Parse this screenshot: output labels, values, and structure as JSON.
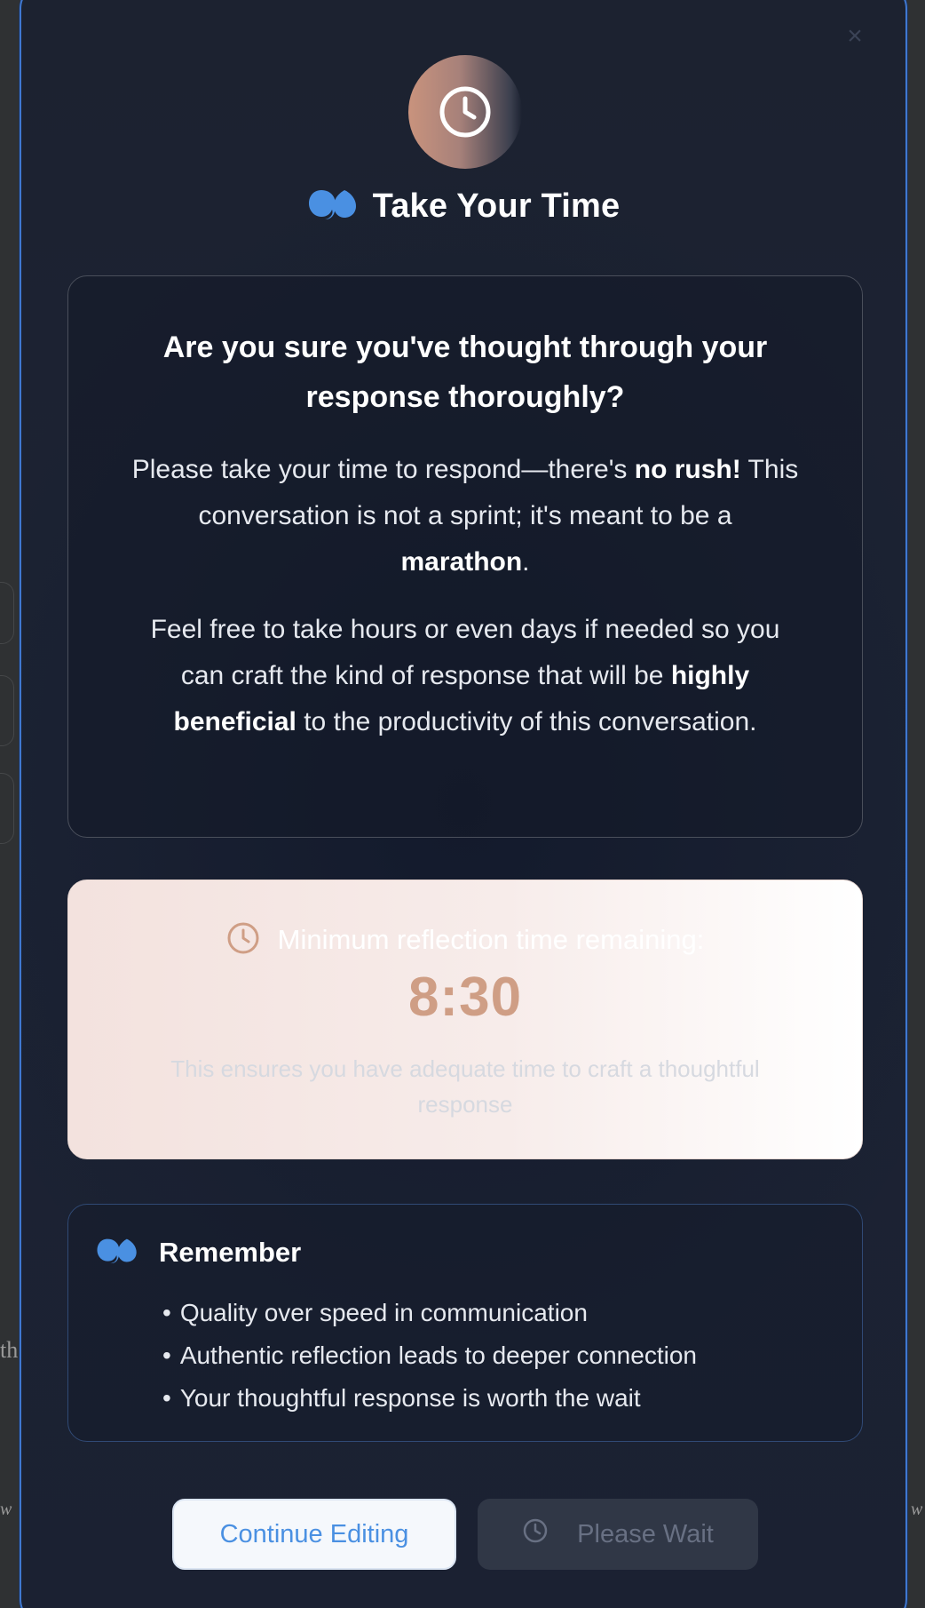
{
  "background": {
    "fragments": [
      "th",
      "w",
      "w"
    ]
  },
  "modal": {
    "close_glyph": "×",
    "icon": "clock-icon",
    "title": "Take Your Time",
    "title_icon": "quote-icon",
    "question": "Are you sure you've thought through your response thoroughly?",
    "paragraph1": {
      "part1": "Please take your time to respond—there's ",
      "bold1": "no rush!",
      "part2": " This conversation is not a sprint; it's meant to be a ",
      "bold2": "marathon",
      "part3": "."
    },
    "paragraph2": {
      "part1": "Feel free to take hours or even days if needed so you can craft the kind of response that will be ",
      "bold": "highly beneficial",
      "part2": " to the productivity of this conversation."
    },
    "timer": {
      "label": "Minimum reflection time remaining:",
      "value": "8:30",
      "note": "This ensures you have adequate time to craft a thoughtful response"
    },
    "remember": {
      "title": "Remember",
      "items": [
        "Quality over speed in communication",
        "Authentic reflection leads to deeper connection",
        "Your thoughtful response is worth the wait"
      ]
    },
    "buttons": {
      "continue_label": "Continue Editing",
      "wait_label": "Please Wait"
    }
  },
  "colors": {
    "accent": "#4a90e2",
    "timer_value": "#cf9e85",
    "border_blue": "#3f78d1"
  }
}
